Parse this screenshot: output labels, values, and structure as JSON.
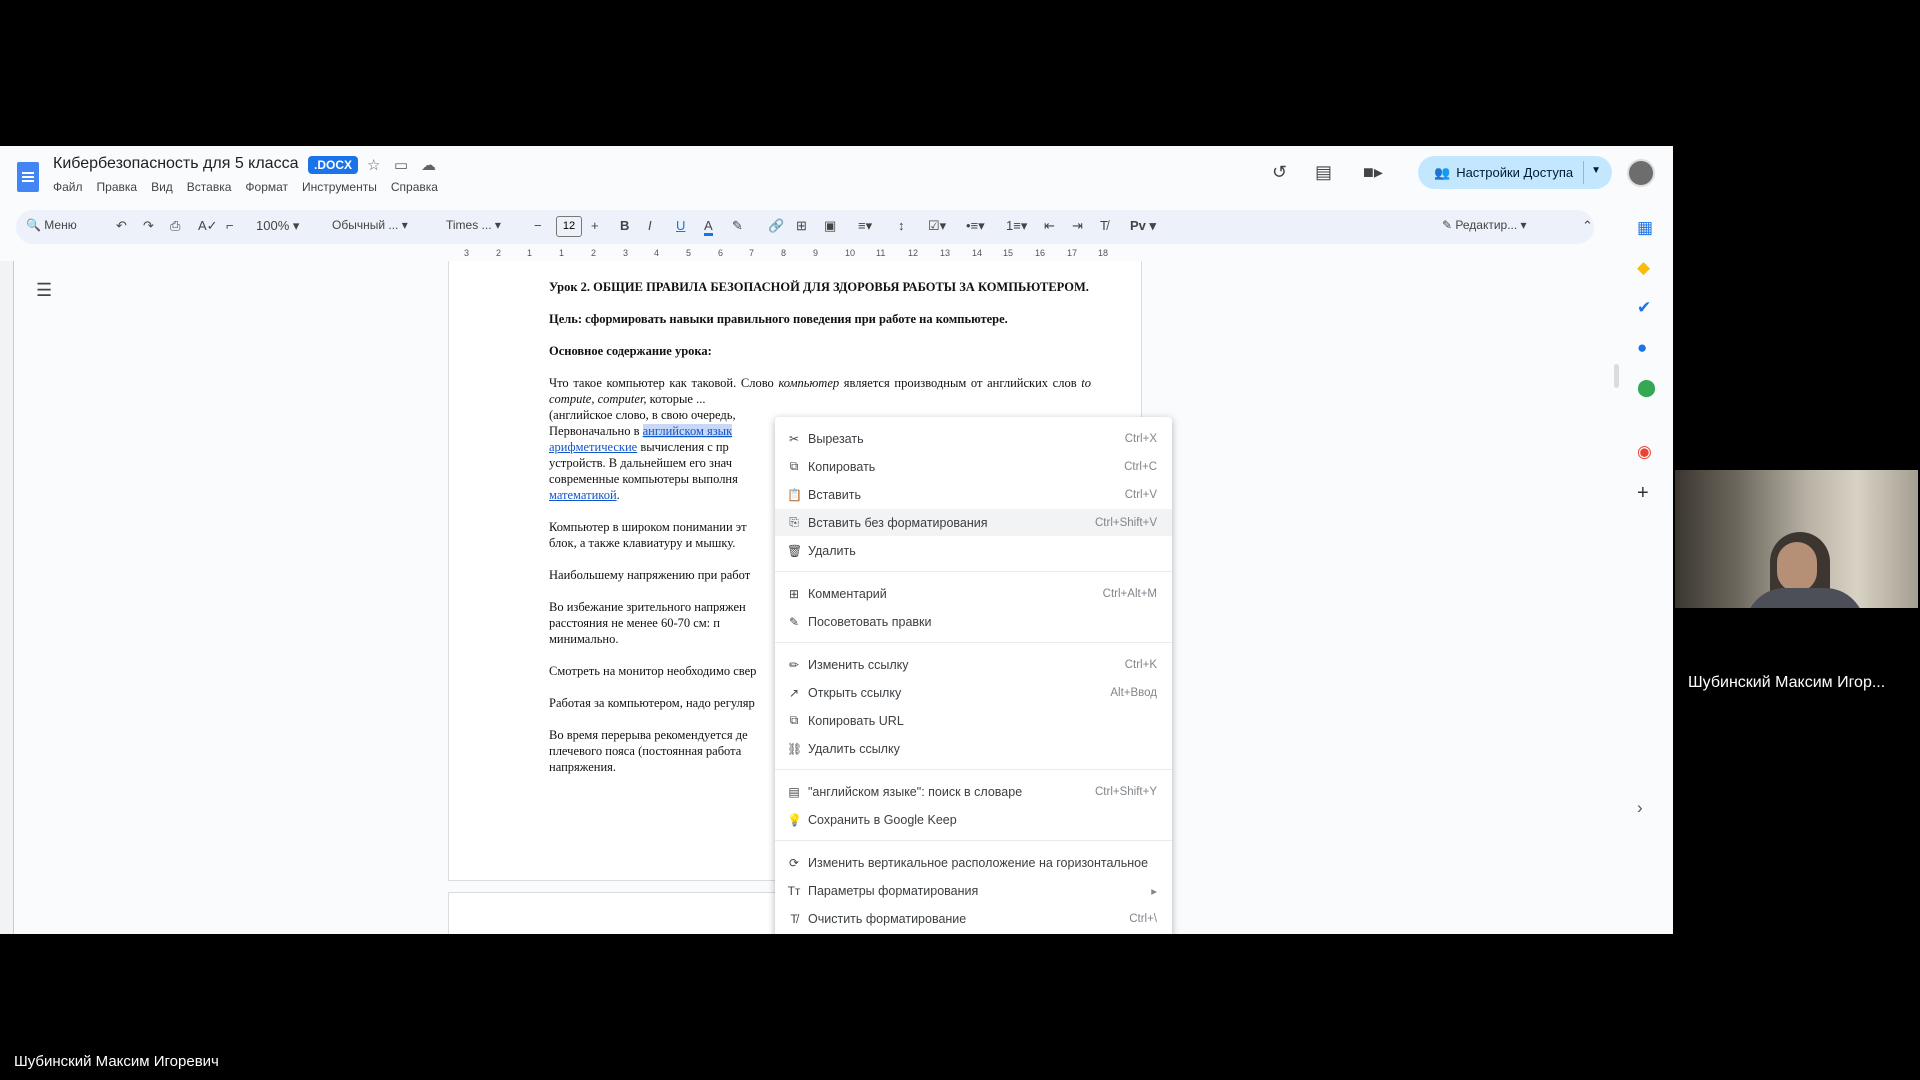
{
  "doc": {
    "title": "Кибербезопасность для 5 класса",
    "badge": ".DOCX",
    "menu": [
      "Файл",
      "Правка",
      "Вид",
      "Вставка",
      "Формат",
      "Инструменты",
      "Справка"
    ],
    "share_label": "Настройки Доступа"
  },
  "toolbar": {
    "search": "Меню",
    "zoom": "100%",
    "style": "Обычный ...",
    "font": "Times ...",
    "font_size": "12",
    "edit_mode": "Редактир...",
    "ruler_numbers": [
      "3",
      "2",
      "1",
      "1",
      "2",
      "3",
      "4",
      "5",
      "6",
      "7",
      "8",
      "9",
      "10",
      "11",
      "12",
      "13",
      "14",
      "15",
      "16",
      "17",
      "18"
    ]
  },
  "document": {
    "heading": "Урок 2. ОБЩИЕ ПРАВИЛА БЕЗОПАСНОЙ ДЛЯ ЗДОРОВЬЯ РАБОТЫ ЗА КОМПЬЮТЕРОМ.",
    "goal": "Цель: сформировать навыки правильного поведения при работе на компьютере.",
    "content_title": "Основное содержание урока:",
    "p1_a": "Что такое компьютер как таковой. Слово ",
    "p1_b": "компьютер",
    "p1_c": " является производным от английских слов ",
    "p1_d": "to compute, computer,",
    "p1_e": " которые ...",
    "p1_f": "(английское слово, в свою очередь,",
    "p1_g": "Первоначально в ",
    "p1_link1": "английском язык",
    "p1_link2": "арифметические",
    "p1_h": " вычисления с пр",
    "p1_i": "устройств. В дальнейшем его знач",
    "p1_j": "современные компьютеры выполня",
    "p1_link3": "математикой",
    "p2_a": "Компьютер в широком понимании эт",
    "p2_b": "блок, а также клавиатуру и мышку.",
    "p3": "Наибольшему напряжению при работ",
    "p4_a": "Во избежание зрительного напряжен",
    "p4_b": "расстояния не менее 60-70 см: п",
    "p4_c": "минимально.",
    "p5": "Смотреть на монитор необходимо свер",
    "p6": "Работая за компьютером, надо регуляр",
    "p7_a": "Во время перерыва рекомендуется де",
    "p7_b": "плечевого пояса (постоянная работа",
    "p7_c": "напряжения."
  },
  "context_menu": {
    "items": [
      {
        "icon": "scissors-icon",
        "label": "Вырезать",
        "shortcut": "Ctrl+X"
      },
      {
        "icon": "copy-icon",
        "label": "Копировать",
        "shortcut": "Ctrl+C"
      },
      {
        "icon": "paste-icon",
        "label": "Вставить",
        "shortcut": "Ctrl+V"
      },
      {
        "icon": "paste-plain-icon",
        "label": "Вставить без форматирования",
        "shortcut": "Ctrl+Shift+V"
      },
      {
        "icon": "trash-icon",
        "label": "Удалить",
        "shortcut": ""
      },
      {
        "icon": "comment-icon",
        "label": "Комментарий",
        "shortcut": "Ctrl+Alt+M"
      },
      {
        "icon": "suggest-icon",
        "label": "Посоветовать правки",
        "shortcut": ""
      },
      {
        "icon": "pencil-icon",
        "label": "Изменить ссылку",
        "shortcut": "Ctrl+K"
      },
      {
        "icon": "open-link-icon",
        "label": "Открыть ссылку",
        "shortcut": "Alt+Ввод"
      },
      {
        "icon": "copy-url-icon",
        "label": "Копировать URL",
        "shortcut": ""
      },
      {
        "icon": "unlink-icon",
        "label": "Удалить ссылку",
        "shortcut": ""
      },
      {
        "icon": "dictionary-icon",
        "label": "\"английском языке\": поиск в словаре",
        "shortcut": "Ctrl+Shift+Y"
      },
      {
        "icon": "keep-icon",
        "label": "Сохранить в Google Keep",
        "shortcut": ""
      },
      {
        "icon": "rotate-icon",
        "label": "Изменить вертикальное расположение на горизонтальное",
        "shortcut": ""
      },
      {
        "icon": "text-format-icon",
        "label": "Параметры форматирования",
        "shortcut": "▸"
      },
      {
        "icon": "clear-format-icon",
        "label": "Очистить форматирование",
        "shortcut": "Ctrl+\\"
      }
    ]
  },
  "video": {
    "camera_name": "Шубинский Максим Игор...",
    "presenter_name": "Шубинский Максим Игоревич"
  }
}
